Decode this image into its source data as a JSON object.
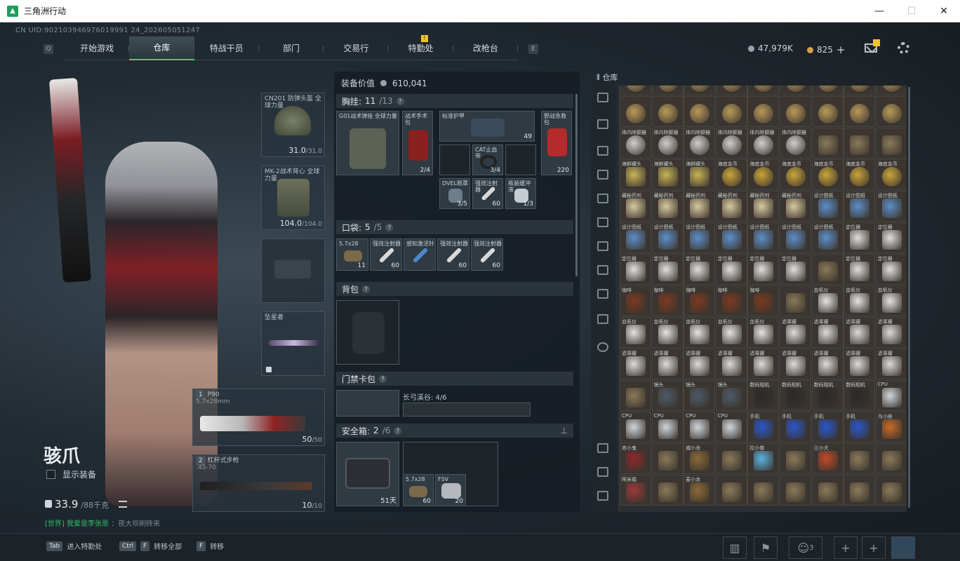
{
  "window": {
    "title": "三角洲行动",
    "minimize": "—",
    "maximize": "☐",
    "close": "✕"
  },
  "uid": "CN UID:902103946976019991 24_202605051247",
  "nav": {
    "left_key": "Q",
    "right_key": "E",
    "tabs": [
      "开始游戏",
      "仓库",
      "特战干员",
      "部门",
      "交易行",
      "特勤处",
      "改枪台"
    ],
    "active": "仓库",
    "badge": "!"
  },
  "currency": {
    "silver": "47,979K",
    "gold": "825",
    "add": "+",
    "silver_color": "#9aa3aa",
    "gold_color": "#d4a546"
  },
  "character": {
    "name": "骇爪",
    "show_gear_label": "显示装备",
    "weight": "33.9",
    "weight_max": "/88千克",
    "chat_channel": "[世界]",
    "chat_name": "我爱是李张思",
    "chat_text": "：夜大坝刷砖来"
  },
  "gear": {
    "helmet": {
      "label": "CN201 防弹头盔 全球力量",
      "count": "31.0",
      "max": "/31.0"
    },
    "armor": {
      "label": "MK-2战术背心 全球力量",
      "count": "104.0",
      "max": "/104.0"
    },
    "melee": {
      "label": "坠星者"
    },
    "weapon1": {
      "slot": "1",
      "name": "P90",
      "ammo_type": "5.7x28mm",
      "count": "50",
      "max": "/50"
    },
    "weapon2": {
      "slot": "2",
      "name": "杠杆式步枪",
      "ammo_type": ".45-70",
      "count": "10",
      "max": "/10"
    }
  },
  "middle": {
    "value_label": "装备价值",
    "value": "610,041",
    "rig": {
      "label": "胸挂:",
      "used": "11",
      "max": "/13"
    },
    "rig_items": [
      {
        "label": "G01战术弹挂 全球力量",
        "count": ""
      },
      {
        "label": "战术手术包",
        "count": "2/4"
      },
      {
        "label": "标准护甲",
        "count": "49"
      },
      {
        "label": "野战急救包",
        "count": "220"
      },
      {
        "label": "CAT止血带",
        "count": "3/4"
      },
      {
        "label": "DVEL眼罩",
        "count": "3/5"
      },
      {
        "label": "强效注射器",
        "count": "60"
      },
      {
        "label": "瓶装缓冲液",
        "count": "1/3"
      }
    ],
    "pocket": {
      "label": "口袋:",
      "used": "5",
      "max": "/5"
    },
    "pocket_items": [
      {
        "label": "5.7x28",
        "count": "11"
      },
      {
        "label": "强效注射器",
        "count": "60"
      },
      {
        "label": "感知激活针",
        "count": ""
      },
      {
        "label": "强效注射器",
        "count": "60"
      },
      {
        "label": "强效注射器",
        "count": "60"
      }
    ],
    "backpack": {
      "label": "背包"
    },
    "keycard": {
      "label": "门禁卡包",
      "sub": "长弓溪谷: 4/6"
    },
    "safebox": {
      "label": "安全箱:",
      "used": "2",
      "max": "/6",
      "days": "51天"
    },
    "safebox_items": [
      {
        "label": "5.7x28",
        "count": "60"
      },
      {
        "label": "FSV",
        "count": "20"
      }
    ]
  },
  "inventory": {
    "title": "仓库",
    "rows": [
      [
        "",
        "",
        "",
        "",
        "",
        "",
        "",
        "",
        "",
        ""
      ],
      [
        "",
        "",
        "",
        "",
        "",
        "",
        "",
        "",
        "",
        ""
      ],
      [
        "体内除颤器",
        "体内除颤器",
        "体内除颤器",
        "体内除颤器",
        "体内除颤器",
        "体内除颤器",
        "",
        "",
        "",
        "海鲜罐头"
      ],
      [
        "海鲜罐头",
        "海鲜罐头",
        "海鲜罐头",
        "海底金币",
        "海底金币",
        "海底金币",
        "海底金币",
        "海底金币",
        "海底金币",
        "藏秘药剂"
      ],
      [
        "藏秘药剂",
        "藏秘药剂",
        "藏秘药剂",
        "藏秘药剂",
        "藏秘药剂",
        "藏秘药剂",
        "设计图纸",
        "设计图纸",
        "设计图纸",
        ""
      ],
      [
        "设计图纸",
        "设计图纸",
        "设计图纸",
        "设计图纸",
        "设计图纸",
        "设计图纸",
        "设计图纸",
        "定位器",
        "定位器",
        ""
      ],
      [
        "定位器",
        "定位器",
        "定位器",
        "定位器",
        "定位器",
        "定位器",
        "",
        "定位器",
        "定位器",
        ""
      ],
      [
        "咖啡",
        "咖啡",
        "咖啡",
        "咖啡",
        "咖啡",
        "",
        "血氧仪",
        "血氧仪",
        "血氧仪",
        ""
      ],
      [
        "血氧仪",
        "血氧仪",
        "血氧仪",
        "血氧仪",
        "血氧仪",
        "滤毒罐",
        "滤毒罐",
        "滤毒罐",
        "滤毒罐",
        ""
      ],
      [
        "滤毒罐",
        "滤毒罐",
        "滤毒罐",
        "滤毒罐",
        "滤毒罐",
        "滤毒罐",
        "滤毒罐",
        "滤毒罐",
        "滤毒罐",
        ""
      ],
      [
        "",
        "镜头",
        "镜头",
        "镜头",
        "数码相机",
        "数码相机",
        "数码相机",
        "数码相机",
        "CPU",
        ""
      ],
      [
        "CPU",
        "CPU",
        "CPU",
        "CPU",
        "手机",
        "手机",
        "手机",
        "手机",
        "乌小座",
        ""
      ],
      [
        "赤小鬼",
        "",
        "威小龙",
        "",
        "拉小普",
        "",
        "兰小犬",
        "",
        "",
        ""
      ],
      [
        "阿米福",
        "",
        "麦小龙",
        "",
        "",
        "",
        "",
        "",
        "",
        ""
      ]
    ]
  },
  "bottom": {
    "hint1_key": "Tab",
    "hint1": "进入特勤处",
    "hint2_key": "Ctrl",
    "hint2_key2": "F",
    "hint2": "转移全部",
    "hint3_key": "F",
    "hint3": "转移",
    "team_count": "3",
    "plus": "+"
  }
}
